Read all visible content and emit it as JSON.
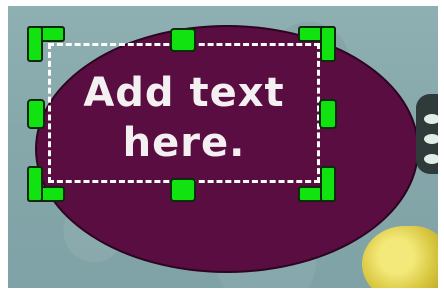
{
  "text_box": {
    "content": "Add text\nhere."
  },
  "colors": {
    "ellipse_fill": "#5a0d41",
    "handle_fill": "#11e311",
    "background": "#8aacaf",
    "text": "#f4f0f2"
  },
  "icons": {
    "handle": "resize-handle-icon",
    "corner": "resize-corner-icon"
  }
}
